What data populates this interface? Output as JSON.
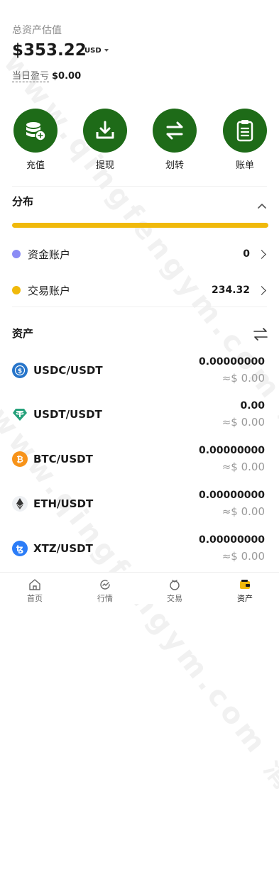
{
  "watermark": "www.qingfengym.com 清风源码",
  "summary": {
    "label": "总资产估值",
    "amount": "$353.22",
    "currency": "USD",
    "pnl_label": "当日盈亏",
    "pnl_value": "$0.00"
  },
  "actions": [
    {
      "label": "充值",
      "icon": "coins-plus-icon"
    },
    {
      "label": "提现",
      "icon": "download-tray-icon"
    },
    {
      "label": "划转",
      "icon": "transfer-arrows-icon"
    },
    {
      "label": "账单",
      "icon": "clipboard-icon"
    }
  ],
  "distribution": {
    "title": "分布",
    "accounts": [
      {
        "name": "资金账户",
        "value": "0",
        "color": "#8b8cf5"
      },
      {
        "name": "交易账户",
        "value": "234.32",
        "color": "#f0b90b"
      }
    ]
  },
  "assets": {
    "title": "资产",
    "items": [
      {
        "pair": "USDC/USDT",
        "amount": "0.00000000",
        "usd": "≈$ 0.00",
        "icon": "usdc-icon",
        "color": "#2775ca"
      },
      {
        "pair": "USDT/USDT",
        "amount": "0.00",
        "usd": "≈$ 0.00",
        "icon": "usdt-icon",
        "color": "#26a17b"
      },
      {
        "pair": "BTC/USDT",
        "amount": "0.00000000",
        "usd": "≈$ 0.00",
        "icon": "btc-icon",
        "color": "#f7931a"
      },
      {
        "pair": "ETH/USDT",
        "amount": "0.00000000",
        "usd": "≈$ 0.00",
        "icon": "eth-icon",
        "color": "#627eea"
      },
      {
        "pair": "XTZ/USDT",
        "amount": "0.00000000",
        "usd": "≈$ 0.00",
        "icon": "xtz-icon",
        "color": "#2c7df7"
      }
    ]
  },
  "tabbar": {
    "tabs": [
      {
        "label": "首页"
      },
      {
        "label": "行情"
      },
      {
        "label": "交易"
      },
      {
        "label": "资产"
      }
    ],
    "active_color": "#f0b90b"
  }
}
